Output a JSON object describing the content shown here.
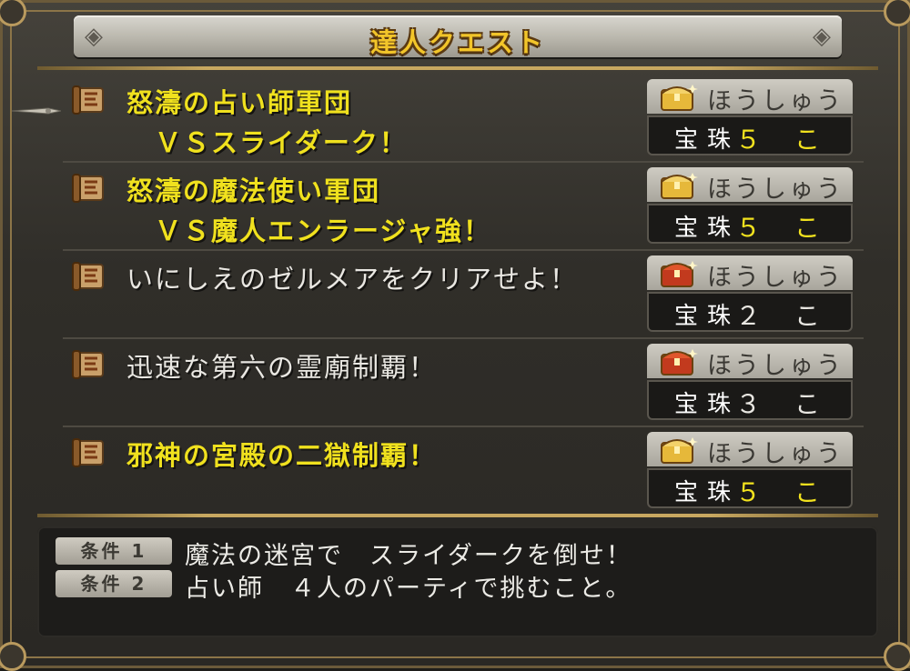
{
  "title": "達人クエスト",
  "quests": [
    {
      "name": "怒濤の占い師軍団\n　ＶＳスライダーク！",
      "color": "gold",
      "reward_label": "ほうしゅう",
      "reward_item": "宝珠",
      "reward_count": "５ こ",
      "count_color": "gold",
      "chest": "gold-chest-icon"
    },
    {
      "name": "怒濤の魔法使い軍団\n　ＶＳ魔人エンラージャ強！",
      "color": "gold",
      "reward_label": "ほうしゅう",
      "reward_item": "宝珠",
      "reward_count": "５ こ",
      "count_color": "gold",
      "chest": "gold-chest-icon"
    },
    {
      "name": "いにしえのゼルメアをクリアせよ！",
      "color": "white",
      "reward_label": "ほうしゅう",
      "reward_item": "宝珠",
      "reward_count": "２ こ",
      "count_color": "white",
      "chest": "red-chest-icon"
    },
    {
      "name": "迅速な第六の霊廟制覇！",
      "color": "white",
      "reward_label": "ほうしゅう",
      "reward_item": "宝珠",
      "reward_count": "３ こ",
      "count_color": "white",
      "chest": "red-chest-icon"
    },
    {
      "name": "邪神の宮殿の二獄制覇！",
      "color": "gold",
      "reward_label": "ほうしゅう",
      "reward_item": "宝珠",
      "reward_count": "５ こ",
      "count_color": "gold",
      "chest": "gold-chest-icon"
    }
  ],
  "conditions": [
    {
      "tag": "条件 1",
      "text": "魔法の迷宮で　スライダークを倒せ！"
    },
    {
      "tag": "条件 2",
      "text": "占い師　４人のパーティで挑むこと。"
    }
  ],
  "colors": {
    "gold_text": "#f0e11e",
    "white_text": "#e9e7e2",
    "title_text": "#f2c52a",
    "panel_bg": "#302e29"
  }
}
